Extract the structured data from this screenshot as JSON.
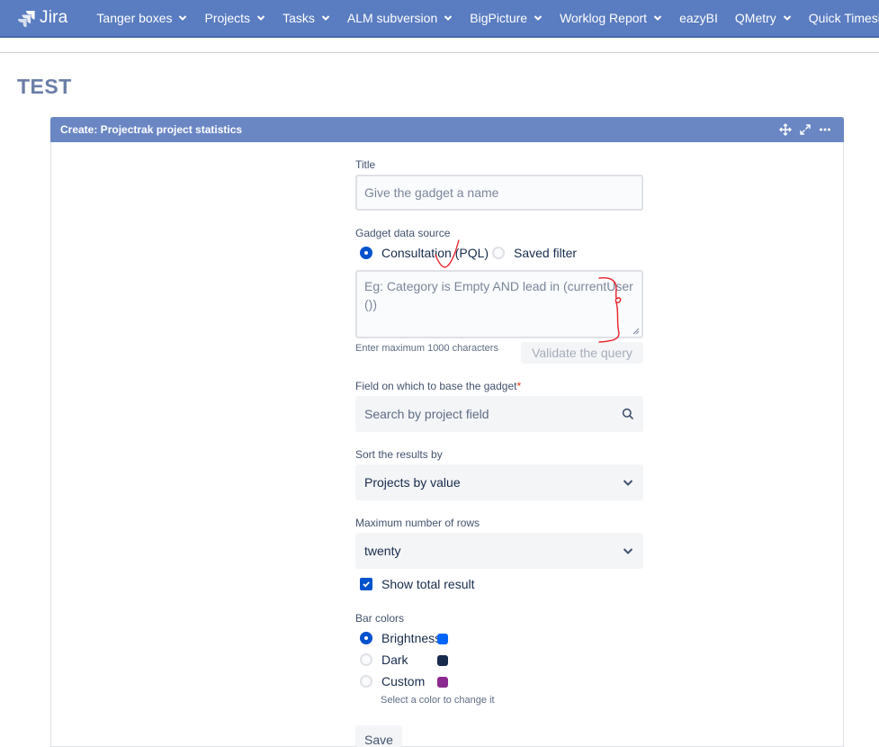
{
  "nav": {
    "logo_text": "Jira",
    "items": [
      {
        "label": "Tanger boxes"
      },
      {
        "label": "Projects"
      },
      {
        "label": "Tasks"
      },
      {
        "label": "ALM subversion"
      },
      {
        "label": "BigPicture"
      },
      {
        "label": "Worklog Report"
      },
      {
        "label": "eazyBI"
      },
      {
        "label": "QMetry"
      },
      {
        "label": "Quick Timesheets"
      }
    ]
  },
  "page": {
    "title": "TEST"
  },
  "gadget": {
    "title": "Create: Projectrak project statistics",
    "tool_icons": [
      "move-icon",
      "expand-icon",
      "more-icon"
    ],
    "form": {
      "title_label": "Title",
      "title_placeholder": "Give the gadget a name",
      "source_label": "Gadget data source",
      "source_options": [
        {
          "label": "Consultation (PQL)",
          "selected": true
        },
        {
          "label": "Saved filter",
          "selected": false
        }
      ],
      "query_placeholder": "Eg: Category is Empty AND lead in (currentUser ())",
      "query_hint": "Enter maximum 1000 characters",
      "validate_label": "Validate the query",
      "field_label": "Field on which to base the gadget",
      "field_required": "*",
      "field_placeholder": "Search by project field",
      "sort_label": "Sort the results by",
      "sort_value": "Projects by value",
      "rows_label": "Maximum number of rows",
      "rows_value": "twenty",
      "total_label": "Show total result",
      "total_checked": true,
      "colors_label": "Bar colors",
      "color_options": [
        {
          "label": "Brightness",
          "selected": true,
          "color": "#0065ff"
        },
        {
          "label": "Dark",
          "selected": false,
          "color": "#172b4d"
        },
        {
          "label": "Custom",
          "selected": false,
          "color": "#8b2a8e"
        }
      ],
      "color_hint": "Select a color to change it",
      "save_label": "Save"
    }
  },
  "colors": {
    "nav_bg": "#5a7cc0",
    "gadget_header": "#6a86c3",
    "primary": "#0052cc",
    "annotation": "#e8202a"
  }
}
